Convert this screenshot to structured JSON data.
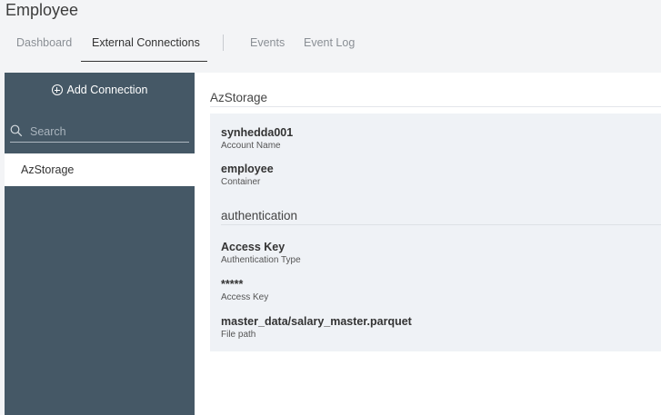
{
  "app": {
    "title": "Employee"
  },
  "tabs": [
    {
      "label": "Dashboard",
      "active": false
    },
    {
      "label": "External Connections",
      "active": true
    },
    {
      "label": "Events",
      "active": false
    },
    {
      "label": "Event Log",
      "active": false
    }
  ],
  "sidebar": {
    "add_connection_label": "Add Connection",
    "search_placeholder": "Search",
    "items": [
      {
        "label": "AzStorage",
        "selected": true
      }
    ],
    "background_color": "#455866"
  },
  "detail": {
    "title": "AzStorage",
    "fields": [
      {
        "value": "synhedda001",
        "label": "Account Name"
      },
      {
        "value": "employee",
        "label": "Container"
      }
    ],
    "auth_section_title": "authentication",
    "auth_fields": [
      {
        "value": "Access Key",
        "label": "Authentication Type"
      },
      {
        "value": "*****",
        "label": "Access Key"
      },
      {
        "value": "master_data/salary_master.parquet",
        "label": "File path"
      }
    ]
  }
}
